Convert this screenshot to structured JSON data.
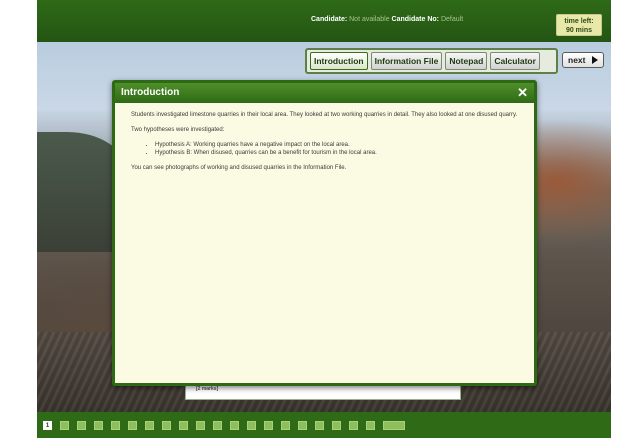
{
  "header": {
    "candidate_label": "Candidate:",
    "candidate_value": "Not available",
    "candidate_no_label": "Candidate No:",
    "candidate_no_value": "Default",
    "time_label": "time left:",
    "time_value": "90 mins"
  },
  "toolbar": {
    "introduction_label": "Introduction",
    "information_file_label": "Information File",
    "notepad_label": "Notepad",
    "calculator_label": "Calculator",
    "next_label": "next"
  },
  "dialog": {
    "title": "Introduction",
    "close_glyph": "✕",
    "paragraph_1": "Students investigated limestone quarries in their local area. They looked at two working quarries in detail. They also looked at one disused quarry.",
    "paragraph_2": "Two hypotheses were investigated:",
    "hypotheses": [
      "Hypothesis A: Working quarries have a negative impact on the local area.",
      "Hypothesis B: When disused, quarries can be a benefit for tourism in the local area."
    ],
    "paragraph_3": "You can see photographs of working and disused quarries in the Information File."
  },
  "answer_box": {
    "label": "[2 marks]"
  },
  "pagination": {
    "current": "1",
    "pages": [
      "1",
      "",
      "",
      "",
      "",
      "",
      "",
      "",
      "",
      "",
      "",
      "",
      "",
      "",
      "",
      "",
      "",
      "",
      "",
      "",
      ""
    ]
  },
  "colors": {
    "frame_green": "#2e6a16",
    "dialog_bg": "#fbfbe4",
    "timer_bg": "#e8e8a8"
  }
}
